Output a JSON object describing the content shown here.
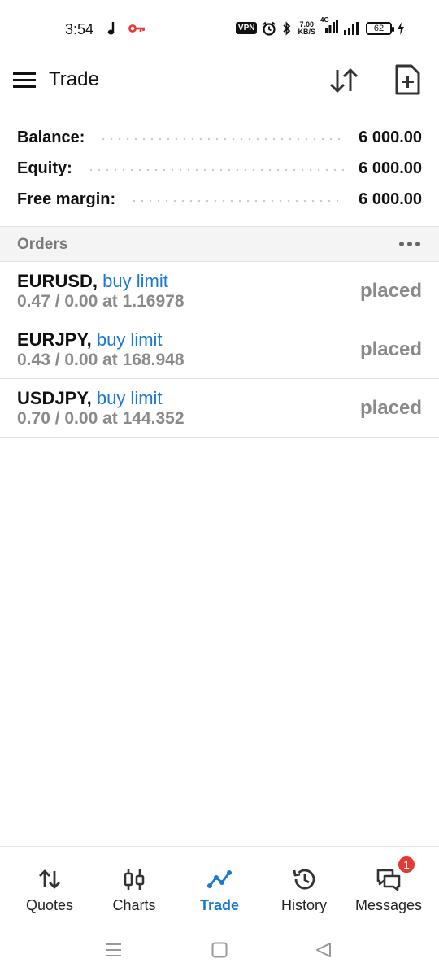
{
  "status_bar": {
    "time": "3:54",
    "vpn": "VPN",
    "speed_value": "7.00",
    "speed_unit": "KB/S",
    "network": "4G",
    "battery": "62"
  },
  "header": {
    "title": "Trade"
  },
  "summary": {
    "rows": [
      {
        "label": "Balance:",
        "value": "6 000.00"
      },
      {
        "label": "Equity:",
        "value": "6 000.00"
      },
      {
        "label": "Free margin:",
        "value": "6 000.00"
      }
    ]
  },
  "orders": {
    "title": "Orders",
    "items": [
      {
        "symbol": "EURUSD,",
        "type": "buy limit",
        "details": "0.47 / 0.00 at 1.16978",
        "status": "placed"
      },
      {
        "symbol": "EURJPY,",
        "type": "buy limit",
        "details": "0.43 / 0.00 at 168.948",
        "status": "placed"
      },
      {
        "symbol": "USDJPY,",
        "type": "buy limit",
        "details": "0.70 / 0.00 at 144.352",
        "status": "placed"
      }
    ]
  },
  "bottom_nav": {
    "items": [
      {
        "label": "Quotes",
        "icon": "quotes-icon"
      },
      {
        "label": "Charts",
        "icon": "charts-icon"
      },
      {
        "label": "Trade",
        "icon": "trade-icon",
        "active": true
      },
      {
        "label": "History",
        "icon": "history-icon"
      },
      {
        "label": "Messages",
        "icon": "messages-icon",
        "badge": "1"
      }
    ]
  },
  "colors": {
    "accent": "#1a78d6",
    "muted": "#8a8a8a",
    "badge": "#e53935"
  }
}
